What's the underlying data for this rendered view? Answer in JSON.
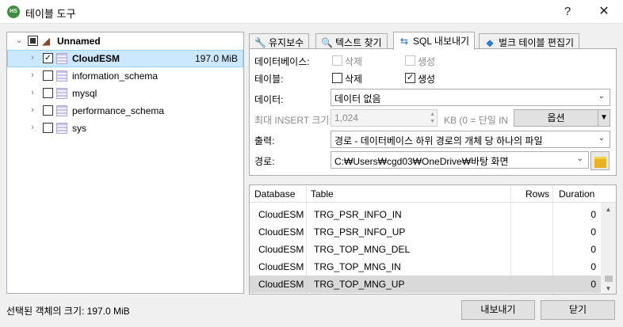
{
  "window": {
    "title": "테이블 도구",
    "help": "?",
    "close": "✕"
  },
  "tree": {
    "root": {
      "label": "Unnamed"
    },
    "items": [
      {
        "label": "CloudESM",
        "size": "197.0 MiB",
        "checked": "✓"
      },
      {
        "label": "information_schema"
      },
      {
        "label": "mysql"
      },
      {
        "label": "performance_schema"
      },
      {
        "label": "sys"
      }
    ]
  },
  "tabs": [
    {
      "label": "유지보수",
      "icon": "wrench-icon"
    },
    {
      "label": "텍스트 찾기",
      "icon": "magnifier-icon"
    },
    {
      "label": "SQL 내보내기",
      "icon": "export-arrows-icon"
    },
    {
      "label": "벌크 테이블 편집기",
      "icon": "table-stack-icon"
    }
  ],
  "export": {
    "database_label": "데이터베이스:",
    "table_label": "테이블:",
    "drop_label": "삭제",
    "create_label": "생성",
    "table_create_checked": "✓",
    "data_label": "데이터:",
    "data_value": "데이터 없음",
    "max_insert_label": "최대 INSERT 크기:",
    "max_insert_value": "1,024",
    "kb_note": "KB (0 = 단일 IN",
    "options_button": "옵션",
    "output_label": "출력:",
    "output_value": "경로 - 데이터베이스 하위 경로의 개체 당 하나의 파일",
    "path_label": "경로:",
    "path_value": "C:₩Users₩cgd03₩OneDrive₩바탕 화면"
  },
  "grid": {
    "columns": [
      "Database",
      "Table",
      "Rows",
      "Duration"
    ],
    "rows": [
      {
        "database": "CloudESM",
        "table": "TRG_PSR_INFO_IN",
        "rows": "",
        "duration": "0"
      },
      {
        "database": "CloudESM",
        "table": "TRG_PSR_INFO_UP",
        "rows": "",
        "duration": "0"
      },
      {
        "database": "CloudESM",
        "table": "TRG_TOP_MNG_DEL",
        "rows": "",
        "duration": "0"
      },
      {
        "database": "CloudESM",
        "table": "TRG_TOP_MNG_IN",
        "rows": "",
        "duration": "0"
      },
      {
        "database": "CloudESM",
        "table": "TRG_TOP_MNG_UP",
        "rows": "",
        "duration": "0"
      }
    ]
  },
  "footer": {
    "status": "선택된 객체의 크기: 197.0 MiB",
    "export_button": "내보내기",
    "close_button": "닫기"
  }
}
